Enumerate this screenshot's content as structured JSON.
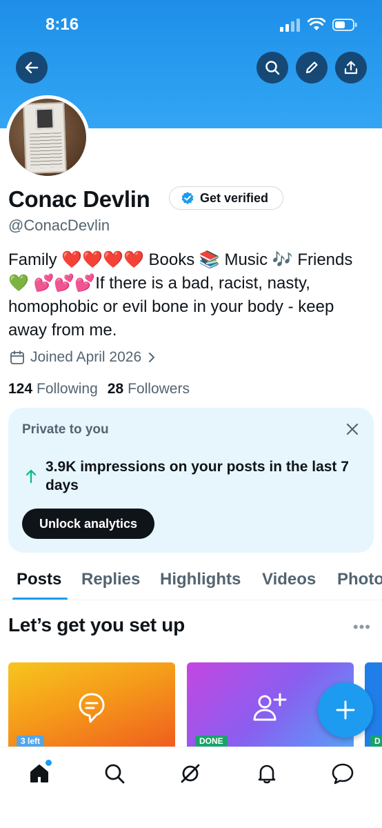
{
  "status_bar": {
    "time": "8:16"
  },
  "profile": {
    "name": "Conac Devlin",
    "verify_label": "Get verified",
    "handle": "@ConacDevlin",
    "bio": "Family ❤️❤️❤️❤️ Books 📚 Music 🎶 Friends 💚 💕💕💕If there is a bad, racist, nasty, homophobic or evil bone in your body - keep away from me.",
    "joined": "Joined April 2026",
    "following_count": "124",
    "following_label": "Following",
    "followers_count": "28",
    "followers_label": "Followers"
  },
  "analytics_card": {
    "title": "Private to you",
    "text": "3.9K impressions on your posts in the last 7 days",
    "button_label": "Unlock analytics"
  },
  "tabs": [
    {
      "label": "Posts",
      "active": true
    },
    {
      "label": "Replies",
      "active": false
    },
    {
      "label": "Highlights",
      "active": false
    },
    {
      "label": "Videos",
      "active": false
    },
    {
      "label": "Photos",
      "active": false
    }
  ],
  "setup": {
    "title": "Let’s get you set up",
    "more_label": "•••",
    "cards": [
      {
        "icon": "chat-bubble-icon",
        "badge": "3 left"
      },
      {
        "icon": "add-person-icon",
        "badge": "DONE"
      },
      {
        "icon": "",
        "badge": "D"
      }
    ]
  },
  "nav": [
    "home-icon",
    "search-icon",
    "grok-icon",
    "notifications-icon",
    "messages-icon"
  ],
  "colors": {
    "accent": "#1d9bf0",
    "banner": "#2a9df0",
    "card_bg": "#e7f6fd"
  }
}
